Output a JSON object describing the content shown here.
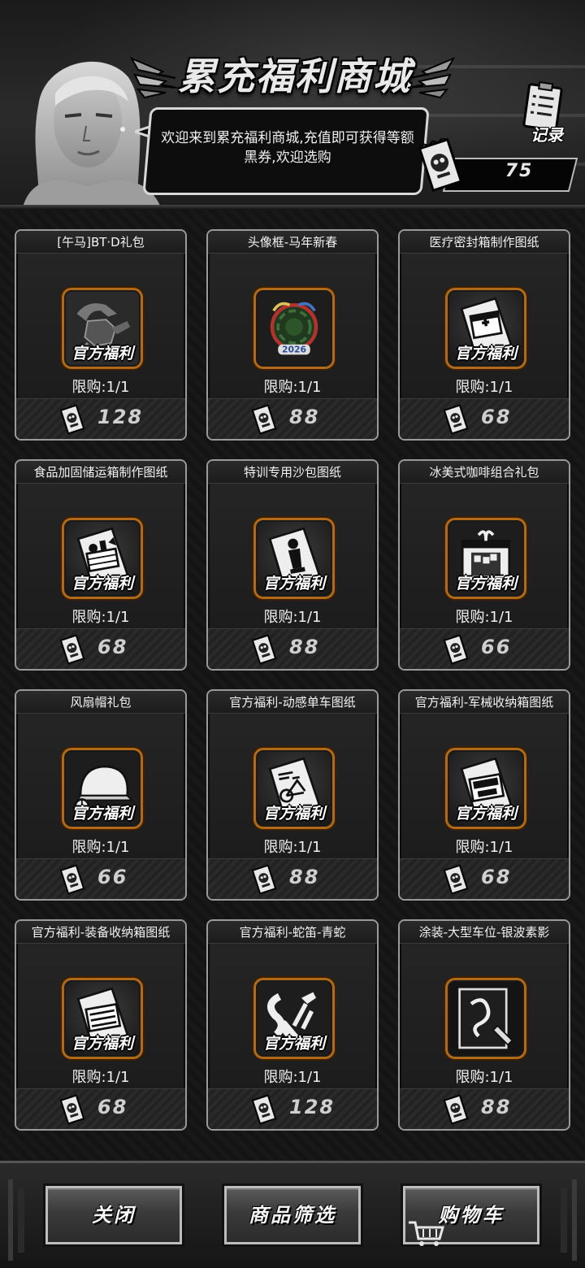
{
  "header": {
    "title": "累充福利商城",
    "welcome": "欢迎来到累充福利商城,充值即可获得等额黑券,欢迎选购",
    "record_label": "记录",
    "balance": "75",
    "portrait_icon": "npc-woman-portrait"
  },
  "items": [
    {
      "name": "[午马]BT·D礼包",
      "badge": "官方福利",
      "limit": "限购:1/1",
      "price": "128",
      "icon": "scorpion-vehicle-icon"
    },
    {
      "name": "头像框-马年新春",
      "badge": "",
      "limit": "限购:1/1",
      "price": "88",
      "icon": "avatar-frame-2026-icon",
      "frame_label": "2026"
    },
    {
      "name": "医疗密封箱制作图纸",
      "badge": "官方福利",
      "limit": "限购:1/1",
      "price": "68",
      "icon": "blueprint-medical-box-icon"
    },
    {
      "name": "食品加固储运箱制作图纸",
      "badge": "官方福利",
      "limit": "限购:1/1",
      "price": "68",
      "icon": "blueprint-food-crate-icon"
    },
    {
      "name": "特训专用沙包图纸",
      "badge": "官方福利",
      "limit": "限购:1/1",
      "price": "88",
      "icon": "blueprint-sandbag-icon"
    },
    {
      "name": "冰美式咖啡组合礼包",
      "badge": "官方福利",
      "limit": "限购:1/1",
      "price": "66",
      "icon": "gift-box-coffee-icon"
    },
    {
      "name": "风扇帽礼包",
      "badge": "官方福利",
      "limit": "限购:1/1",
      "price": "66",
      "icon": "fan-hat-icon"
    },
    {
      "name": "官方福利-动感单车图纸",
      "badge": "官方福利",
      "limit": "限购:1/1",
      "price": "88",
      "icon": "blueprint-bike-icon"
    },
    {
      "name": "官方福利-军械收纳箱图纸",
      "badge": "官方福利",
      "limit": "限购:1/1",
      "price": "68",
      "icon": "blueprint-armory-box-icon"
    },
    {
      "name": "官方福利-装备收纳箱图纸",
      "badge": "官方福利",
      "limit": "限购:1/1",
      "price": "68",
      "icon": "blueprint-gear-box-icon"
    },
    {
      "name": "官方福利-蛇笛-青蛇",
      "badge": "官方福利",
      "limit": "限购:1/1",
      "price": "128",
      "icon": "snake-flute-icon"
    },
    {
      "name": "涂装-大型车位-银波素影",
      "badge": "",
      "limit": "限购:1/1",
      "price": "88",
      "icon": "paint-skin-icon"
    }
  ],
  "footer": {
    "close_label": "关闭",
    "filter_label": "商品筛选",
    "cart_label": "购物车"
  },
  "colors": {
    "item_frame": "#b06a18",
    "card_border": "#9a9a9a",
    "background": "#0e0e0e"
  }
}
